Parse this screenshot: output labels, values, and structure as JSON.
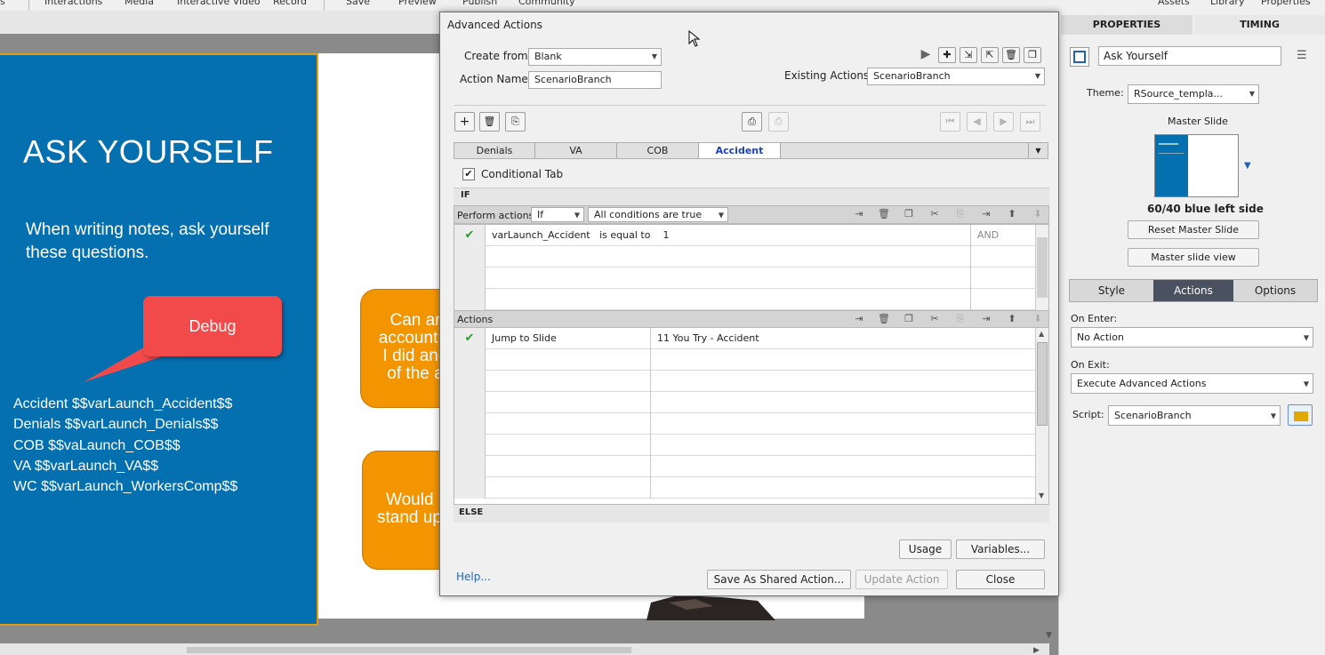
{
  "toolbar": {
    "items": [
      "Interactions",
      "Media",
      "Interactive Video",
      "Record",
      "Save",
      "Preview",
      "Publish",
      "Community",
      "Assets",
      "Library",
      "Properties"
    ]
  },
  "slide": {
    "title": "ASK YOURSELF",
    "body": "When writing notes, ask yourself these questions.",
    "debug_label": "Debug",
    "variables": [
      "Accident $$varLaunch_Accident$$",
      "Denials $$varLaunch_Denials$$",
      "COB $$vaLaunch_COB$$",
      "VA $$varLaunch_VA$$",
      "WC $$varLaunch_WorkersComp$$"
    ],
    "box1_lines": [
      "Can ar",
      "account n",
      "I did and",
      "of the a"
    ],
    "box2_lines": [
      "Would",
      "stand up"
    ]
  },
  "dialog": {
    "title": "Advanced Actions",
    "create_from_label": "Create from:",
    "create_from_value": "Blank",
    "action_name_label": "Action Name:",
    "action_name_value": "ScenarioBranch",
    "existing_actions_label": "Existing Actions:",
    "existing_actions_value": "ScenarioBranch",
    "tabs": [
      "Denials",
      "VA",
      "COB",
      "Accident"
    ],
    "active_tab": "Accident",
    "conditional_tab_label": "Conditional Tab",
    "if_label": "IF",
    "perform_actions_label": "Perform actions:",
    "perform_actions_value": "If",
    "conditions_value": "All conditions are true",
    "condition_rows": [
      {
        "variable": "varLaunch_Accident",
        "operator": "is equal to",
        "value": "1",
        "logic": "AND"
      }
    ],
    "actions_label": "Actions",
    "action_rows": [
      {
        "action": "Jump to Slide",
        "target": "11 You Try - Accident"
      }
    ],
    "else_label": "ELSE",
    "usage_button": "Usage",
    "variables_button": "Variables...",
    "help_link": "Help...",
    "save_shared_button": "Save As Shared Action...",
    "update_button": "Update Action",
    "close_button": "Close"
  },
  "props": {
    "tab_properties": "PROPERTIES",
    "tab_timing": "TIMING",
    "slide_name": "Ask Yourself",
    "theme_label": "Theme:",
    "theme_value": "RSource_templa...",
    "master_slide_label": "Master Slide",
    "master_name": "60/40 blue left side",
    "reset_master_button": "Reset Master Slide",
    "master_view_button": "Master slide view",
    "seg_style": "Style",
    "seg_actions": "Actions",
    "seg_options": "Options",
    "on_enter_label": "On Enter:",
    "on_enter_value": "No Action",
    "on_exit_label": "On Exit:",
    "on_exit_value": "Execute Advanced Actions",
    "script_label": "Script:",
    "script_value": "ScenarioBranch"
  },
  "colors": {
    "slide_blue": "#0470b0",
    "debug_red": "#f24a4a",
    "orange": "#f29500",
    "active_tab": "#1a3fbf",
    "seg_active": "#4a5160"
  }
}
